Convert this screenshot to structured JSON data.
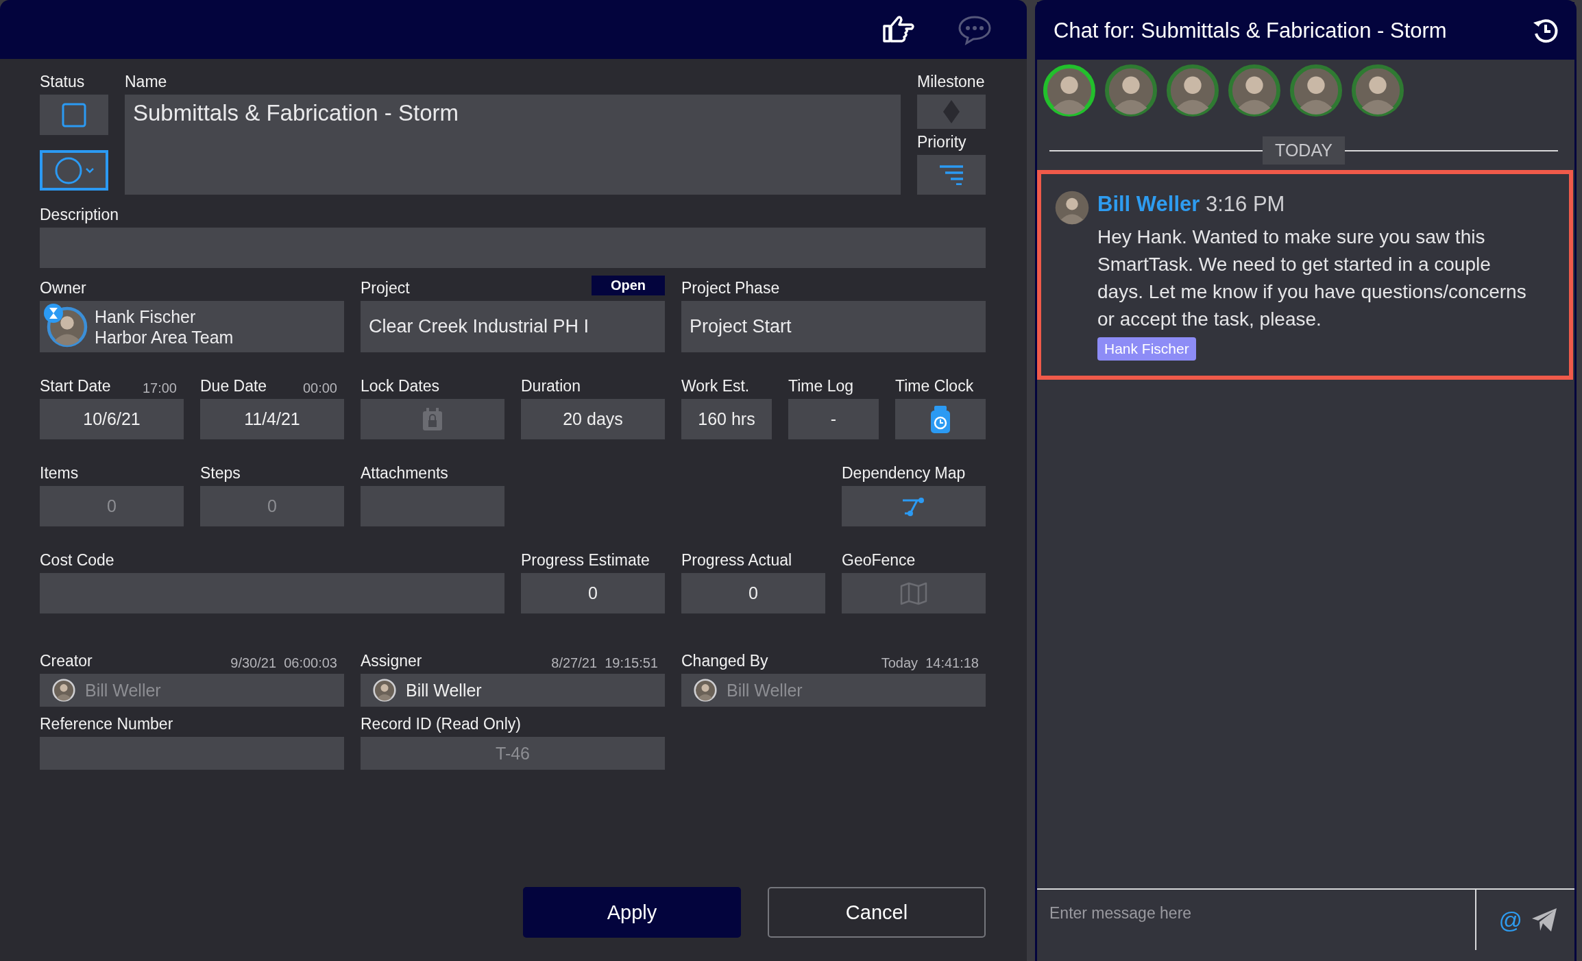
{
  "toolbar": {
    "buttons": [
      {
        "kind": "hand",
        "disabled": false
      },
      {
        "kind": "chat",
        "disabled": true
      }
    ]
  },
  "form": {
    "status": {
      "label": "Status",
      "checked": false
    },
    "name": {
      "label": "Name",
      "value": "Submittals & Fabrication - Storm"
    },
    "milestone": {
      "label": "Milestone",
      "on": false
    },
    "priority": {
      "label": "Priority"
    },
    "description": {
      "label": "Description"
    },
    "owner": {
      "label": "Owner",
      "name": "Hank Fischer",
      "team": "Harbor Area Team"
    },
    "project": {
      "label": "Project",
      "badge": "Open",
      "value": "Clear Creek Industrial PH I"
    },
    "project_phase": {
      "label": "Project Phase",
      "value": "Project Start"
    },
    "sections": [
      {
        "fields": [
          {
            "label": "Start Date",
            "note": "17:00",
            "kind": "text",
            "value": "10/6/21",
            "disabled": false
          },
          {
            "label": "Due Date",
            "note": "00:00",
            "kind": "text",
            "value": "11/4/21",
            "disabled": false
          },
          {
            "label": "Lock Dates",
            "kind": "lock",
            "disabled": true
          },
          {
            "label": "Duration",
            "kind": "text",
            "value": "20 days",
            "disabled": false
          },
          {
            "label": "Work Est.",
            "kind": "text",
            "value": "160 hrs",
            "disabled": false
          },
          {
            "label": "Time Log",
            "kind": "text",
            "value": "-",
            "disabled": false
          },
          {
            "label": "Time Clock",
            "kind": "timer",
            "disabled": false
          }
        ]
      },
      {
        "fields": [
          {
            "label": "Items",
            "kind": "text",
            "value": "0",
            "disabled": true
          },
          {
            "label": "Steps",
            "kind": "text",
            "value": "0",
            "disabled": true
          },
          {
            "label": "Attachments",
            "kind": "blank"
          },
          {
            "label": "Dependency Map",
            "kind": "links",
            "disabled": false
          }
        ]
      },
      {
        "fields": [
          {
            "label": "Cost Code",
            "kind": "blank"
          },
          {
            "label": "Progress Estimate",
            "kind": "text",
            "value": "0",
            "disabled": false
          },
          {
            "label": "Progress Actual",
            "kind": "text",
            "value": "0",
            "disabled": false
          },
          {
            "label": "GeoFence",
            "kind": "map",
            "disabled": true
          }
        ]
      },
      {
        "fields": [
          {
            "label": "Creator",
            "note": "9/30/21  06:00:03",
            "kind": "person",
            "value": "Bill Weller",
            "disabled": true
          },
          {
            "label": "Assigner",
            "note": "8/27/21  19:15:51",
            "kind": "person",
            "value": "Bill Weller",
            "disabled": false
          },
          {
            "label": "Changed By",
            "note": "Today  14:41:18",
            "kind": "person",
            "value": "Bill Weller",
            "disabled": true
          }
        ]
      },
      {
        "fields": [
          {
            "label": "Reference Number",
            "kind": "blank"
          },
          {
            "label": "Record ID (Read Only)",
            "kind": "text",
            "value": "T-46",
            "disabled": true
          }
        ]
      }
    ]
  },
  "buttons": [
    {
      "label": "Apply",
      "kind": "primary"
    },
    {
      "label": "Cancel",
      "kind": "secondary"
    }
  ],
  "chat": {
    "title": "Chat for: Submittals & Fabrication - Storm",
    "participants": [
      {
        "selected": true
      },
      {
        "selected": false
      },
      {
        "selected": false
      },
      {
        "selected": false
      },
      {
        "selected": false
      },
      {
        "selected": false
      }
    ],
    "divider": "TODAY",
    "messages": [
      {
        "author": "Bill Weller",
        "time": "3:16 PM",
        "text": "Hey Hank. Wanted to make sure you saw this SmartTask. We need to get started in a couple days. Let me know if you have questions/concerns or accept the task, please.",
        "mentions": [
          "Hank Fischer"
        ],
        "highlighted": true
      }
    ],
    "input": {
      "placeholder": "Enter message here"
    },
    "mention_button": "@"
  }
}
